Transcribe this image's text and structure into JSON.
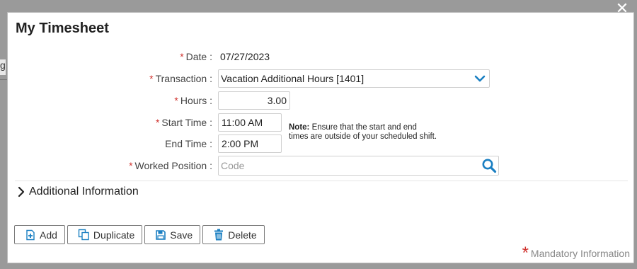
{
  "dialog": {
    "title": "My Timesheet",
    "close_glyph": "✕"
  },
  "background": {
    "fragment_text": "g"
  },
  "form": {
    "date": {
      "label": "Date :",
      "required": true,
      "value": "07/27/2023"
    },
    "transaction": {
      "label": "Transaction :",
      "required": true,
      "value": "Vacation Additional Hours [1401]"
    },
    "hours": {
      "label": "Hours :",
      "required": true,
      "value": "3.00"
    },
    "start_time": {
      "label": "Start Time :",
      "required": true,
      "value": "11:00 AM"
    },
    "end_time": {
      "label": "End Time :",
      "required": false,
      "value": "2:00 PM"
    },
    "worked_position": {
      "label": "Worked Position :",
      "required": true,
      "value": "",
      "placeholder": "Code"
    },
    "required_marker": "*"
  },
  "note": {
    "heading": "Note:",
    "text": "Ensure that the start and end times are outside of your scheduled shift."
  },
  "sections": {
    "additional_info": "Additional Information"
  },
  "buttons": {
    "add": "Add",
    "duplicate": "Duplicate",
    "save": "Save",
    "delete": "Delete"
  },
  "footer": {
    "mandatory_marker": "*",
    "mandatory_text": "Mandatory Information"
  },
  "colors": {
    "accent": "#1a7fc2",
    "required": "#d0312d"
  }
}
